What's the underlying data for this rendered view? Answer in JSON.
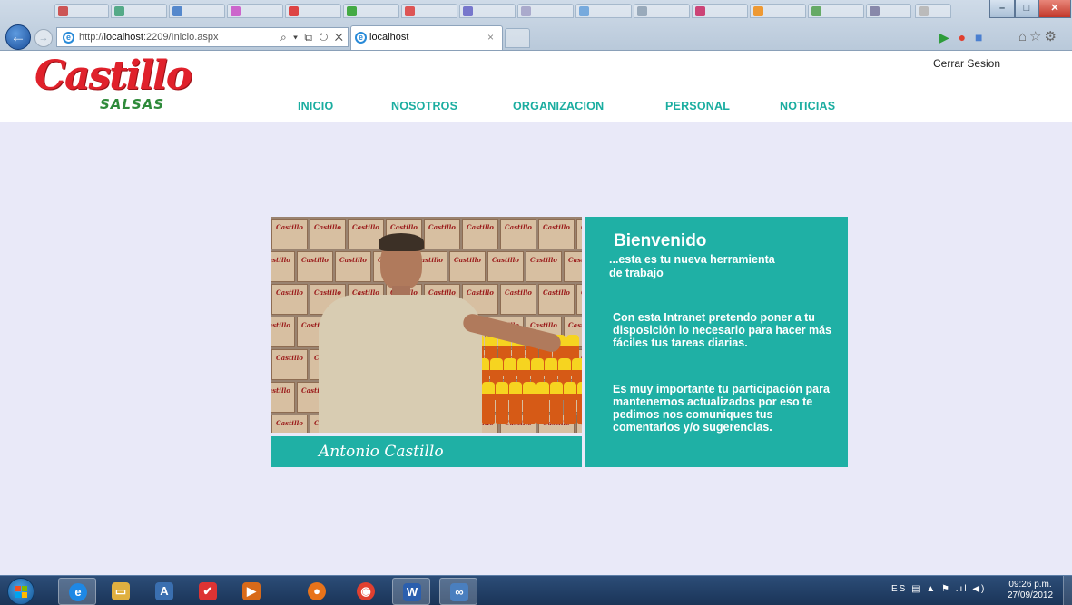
{
  "browser": {
    "address_prefix": "http://",
    "address_host": "localhost",
    "address_rest": ":2209/Inicio.aspx",
    "address_tools": "⌕ ▾ ⧉ ↻ ✕",
    "tab_title": "localhost",
    "tab_close": "×",
    "win_min": "–",
    "win_max": "□",
    "win_close": "✕",
    "home_icons": "⌂☆⚙"
  },
  "site": {
    "logo_main": "Castillo",
    "logo_sub": "SALSAS",
    "logout": "Cerrar Sesion",
    "nav": [
      "INICIO",
      "NOSOTROS",
      "ORGANIZACION",
      "PERSONAL",
      "NOTICIAS"
    ]
  },
  "content": {
    "box_label": "Castillo",
    "caption": "Antonio Castillo",
    "welcome_title": "Bienvenido",
    "welcome_sub": "...esta es tu nueva herramienta de trabajo",
    "paragraph1": "Con esta Intranet pretendo poner a tu\ndisposición lo necesario para hacer más fáciles tus tareas diarias.",
    "paragraph2": "Es muy importante tu participación para mantenernos actualizados por eso te pedimos nos comuniques tus comentarios y/o sugerencias."
  },
  "taskbar": {
    "apps": [
      "internet-explorer",
      "file-explorer",
      "app-a",
      "app-red",
      "app-orange",
      "firefox",
      "chrome",
      "word",
      "other-app"
    ],
    "app_glyphs": [
      "e",
      "▭",
      "A",
      "✔",
      "▶",
      "●",
      "◉",
      "W",
      "∞"
    ],
    "tray_text": "ES ▤ ▲ ⚑ .ıl ◀)",
    "time": "09:26 p.m.",
    "date": "27/09/2012"
  },
  "colors": {
    "teal": "#1fb0a5",
    "page_bg": "#e9e9f8",
    "nav_text": "#1aada0",
    "logo_red": "#e0212b",
    "logo_green": "#2e8a3a"
  }
}
